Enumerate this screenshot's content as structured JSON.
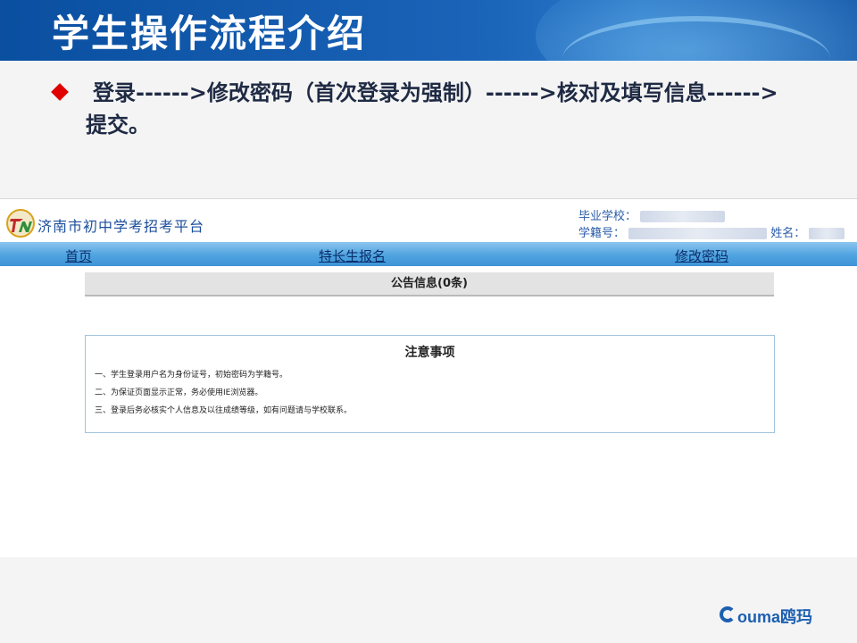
{
  "slide": {
    "title": "学生操作流程介绍",
    "bullet": "登录------>修改密码（首次登录为强制）------>核对及填写信息------>提交。"
  },
  "site": {
    "name": "济南市初中学考招考平台",
    "info": {
      "school_label": "毕业学校：",
      "student_id_label": "学籍号：",
      "name_label": "姓名："
    },
    "nav": {
      "home": "首页",
      "talent": "特长生报名",
      "change_password": "修改密码"
    },
    "notice_bar": "公告信息(0条)",
    "caution": {
      "title": "注意事项",
      "items": [
        "一、学生登录用户名为身份证号，初始密码为学籍号。",
        "二、为保证页面显示正常，务必使用IE浏览器。",
        "三、登录后务必核实个人信息及以往成绩等级，如有问题请与学校联系。"
      ]
    }
  },
  "footer": {
    "brand": "ouma鸥玛"
  },
  "colors": {
    "header_blue": "#1a63b8",
    "nav_blue": "#4fa3e0",
    "bullet_red": "#e00000",
    "link_dark": "#0b2e6b"
  },
  "icons": [
    "bullet-diamond-icon",
    "site-logo-icon",
    "ouma-logo-icon"
  ]
}
